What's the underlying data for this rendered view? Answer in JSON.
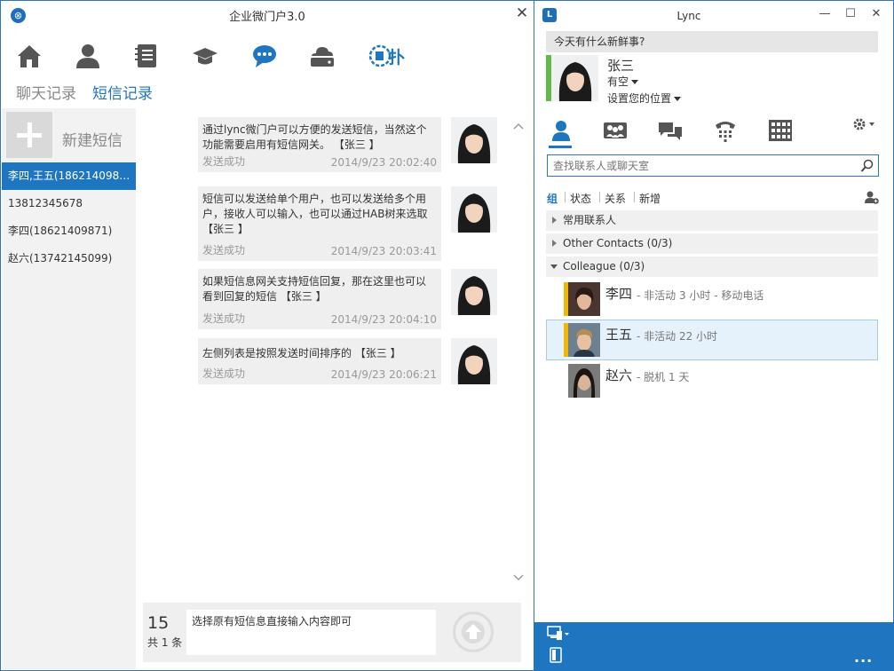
{
  "left_window": {
    "title": "企业微门户3.0",
    "close_label": "✕",
    "nav_icons": [
      "home-icon",
      "user-icon",
      "contacts-book-icon",
      "graduation-cap-icon",
      "message-icon",
      "cloud-drive-icon",
      "sms-icon"
    ],
    "tabs": {
      "chat": "聊天记录",
      "sms": "短信记录"
    },
    "new_sms_label": "新建短信",
    "conversations": [
      {
        "label": "李四,王五(18621409871,...",
        "active": true
      },
      {
        "label": "13812345678"
      },
      {
        "label": "李四(18621409871)"
      },
      {
        "label": "赵六(13742145099)"
      }
    ],
    "messages": [
      {
        "text": "通过lync微门户可以方便的发送短信，当然这个功能需要启用有短信网关。 【张三 】",
        "status": "发送成功",
        "time": "2014/9/23 20:02:40"
      },
      {
        "text": "短信可以发送给单个用户，也可以发送给多个用户，接收人可以输入，也可以通过HAB树来选取 【张三 】",
        "status": "发送成功",
        "time": "2014/9/23 20:03:41"
      },
      {
        "text": "如果短信息网关支持短信回复，那在这里也可以看到回复的短信 【张三 】",
        "status": "发送成功",
        "time": "2014/9/23 20:04:10"
      },
      {
        "text": "左侧列表是按照发送时间排序的 【张三 】",
        "status": "发送成功",
        "time": "2014/9/23 20:06:21"
      }
    ],
    "compose": {
      "count": "15",
      "total": "共 1 条",
      "input_value": "选择原有短信息直接输入内容即可"
    }
  },
  "lync": {
    "title": "Lync",
    "whats_new_placeholder": "今天有什么新鲜事?",
    "me": {
      "name": "张三",
      "status": "有空",
      "location": "设置您的位置"
    },
    "tabs": [
      "contacts-icon",
      "groups-icon",
      "conversations-icon",
      "phone-icon",
      "dialpad-icon"
    ],
    "search_placeholder": "查找联系人或聊天室",
    "filters": [
      "组",
      "状态",
      "关系",
      "新增"
    ],
    "groups": [
      {
        "label": "常用联系人",
        "expanded": false
      },
      {
        "label": "Other Contacts (0/3)",
        "expanded": false
      },
      {
        "label": "Colleague (0/3)",
        "expanded": true
      }
    ],
    "contacts": [
      {
        "name": "李四",
        "status": "- 非活动 3 小时 - 移动电话",
        "presence_color": "#f2b705"
      },
      {
        "name": "王五",
        "status": "- 非活动 22 小时",
        "presence_color": "#f2b705",
        "selected": true
      },
      {
        "name": "赵六",
        "status": "- 脱机 1 天",
        "presence_color": "#ffffff"
      }
    ],
    "more_label": "..."
  },
  "colors": {
    "accent": "#1f76c0",
    "available": "#5fb94a",
    "away": "#f2b705"
  }
}
